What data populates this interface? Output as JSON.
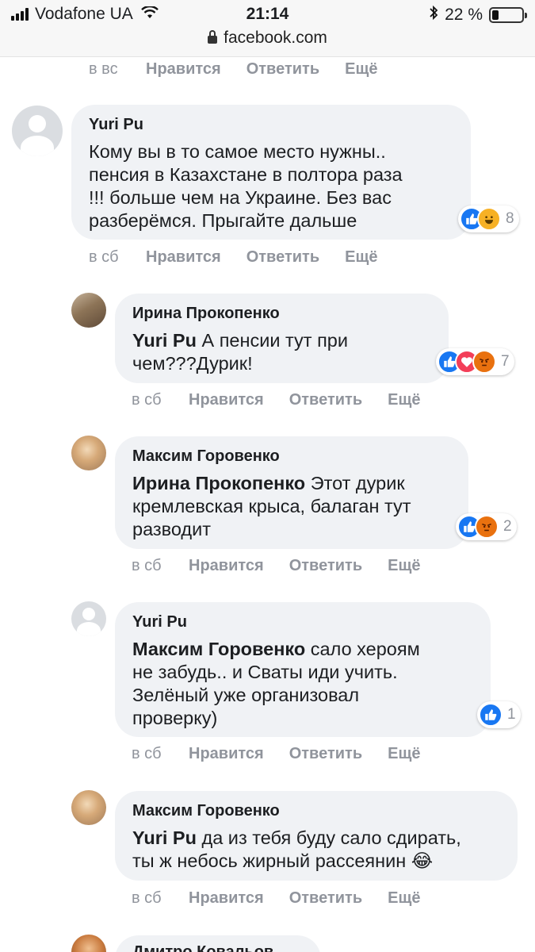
{
  "status_bar": {
    "carrier": "Vodafone UA",
    "time": "21:14",
    "battery": "22 %",
    "battery_level": 0.22,
    "url": "facebook.com"
  },
  "top_actions": {
    "time": "в вс",
    "like": "Нравится",
    "reply": "Ответить",
    "more": "Ещё"
  },
  "comments": [
    {
      "author": "Yuri Pu",
      "mention": "",
      "text": "Кому вы в то самое место нужны.. пенсия в Казахстане в полтора раза !!! больше чем на Украине. Без вас разберёмся. Прыгайте дальше",
      "lines": [
        "Кому вы в то самое место нужны..",
        "пенсия в Казахстане в полтора раза",
        "!!! больше чем на Украине. Без вас",
        "разберёмся. Прыгайте дальше"
      ],
      "reactions": [
        "like",
        "haha"
      ],
      "reaction_count": "8",
      "time": "в сб",
      "like": "Нравится",
      "reply": "Ответить",
      "more": "Ещё"
    },
    {
      "author": "Ирина Прокопенко",
      "mention": "Yuri Pu",
      "lines": [
        "А пенсии тут при",
        "чем???Дурик!"
      ],
      "reactions": [
        "like",
        "love",
        "angry"
      ],
      "reaction_count": "7",
      "time": "в сб",
      "like": "Нравится",
      "reply": "Ответить",
      "more": "Ещё"
    },
    {
      "author": "Максим Горовенко",
      "mention": "Ирина Прокопенко",
      "lines": [
        "Этот дурик",
        "кремлевская крыса, балаган тут",
        "разводит"
      ],
      "reactions": [
        "like",
        "angry"
      ],
      "reaction_count": "2",
      "time": "в сб",
      "like": "Нравится",
      "reply": "Ответить",
      "more": "Ещё"
    },
    {
      "author": "Yuri Pu",
      "mention": "Максим Горовенко",
      "lines": [
        "сало хероям",
        "не забудь.. и Сваты иди учить.",
        "Зелёный уже организовал",
        "проверку)"
      ],
      "reactions": [
        "like"
      ],
      "reaction_count": "1",
      "time": "в сб",
      "like": "Нравится",
      "reply": "Ответить",
      "more": "Ещё"
    },
    {
      "author": "Максим Горовенко",
      "mention": "Yuri Pu",
      "lines": [
        "да из тебя буду сало сдирать,",
        "ты ж небось жирный рассеянин 😂"
      ],
      "reactions": [],
      "reaction_count": "",
      "time": "в сб",
      "like": "Нравится",
      "reply": "Ответить",
      "more": "Ещё"
    },
    {
      "author": "Дмитро Ковальов",
      "partial": true
    }
  ]
}
